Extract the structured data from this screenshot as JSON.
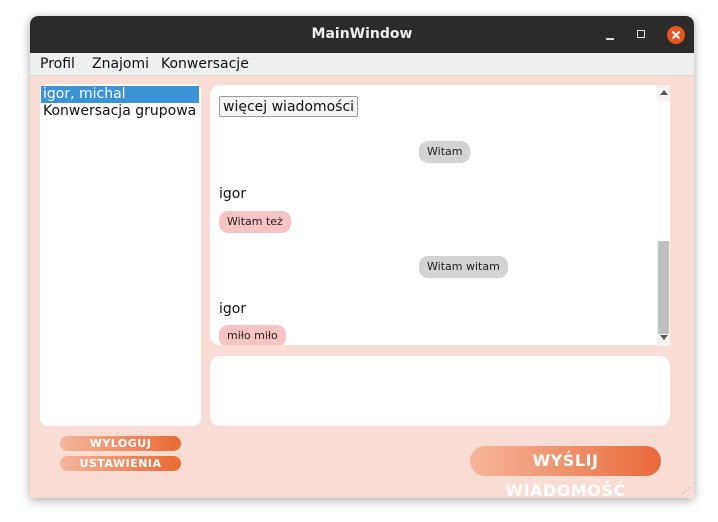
{
  "window": {
    "title": "MainWindow"
  },
  "menu": [
    "Profil",
    "Znajomi",
    "Konwersacje"
  ],
  "contacts": [
    {
      "label": "igor, michal",
      "selected": true
    },
    {
      "label": "Konwersacja grupowa",
      "selected": false
    }
  ],
  "chat": {
    "more_label": "więcej wiadomości",
    "messages": [
      {
        "from": "me",
        "text": "Witam"
      },
      {
        "from": "igor",
        "sender": "igor",
        "text": "Witam też"
      },
      {
        "from": "me",
        "text": "Witam witam"
      },
      {
        "from": "igor",
        "sender": "igor",
        "text": "miło miło"
      }
    ]
  },
  "compose": {
    "value": ""
  },
  "buttons": {
    "logout": "WYLOGUJ",
    "settings": "USTAWIENIA",
    "send": "WYŚLIJ WIADOMOŚĆ"
  },
  "colors": {
    "window_bg": "#f9dcd3",
    "titlebar": "#2b2b2b",
    "selection": "#3a93d6",
    "my_bubble": "#d3d3d3",
    "their_bubble": "#f8c3c3",
    "accent": "#e95420"
  }
}
